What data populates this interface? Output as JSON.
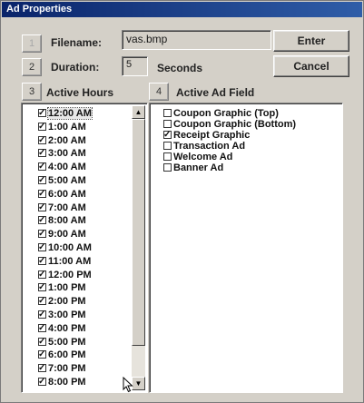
{
  "window": {
    "title": "Ad Properties"
  },
  "row1": {
    "num": "1",
    "label": "Filename:",
    "value": "vas.bmp",
    "button": "Enter"
  },
  "row2": {
    "num": "2",
    "label": "Duration:",
    "value": "5",
    "unit": "Seconds",
    "button": "Cancel"
  },
  "active_hours": {
    "num": "3",
    "label": "Active Hours",
    "items": [
      {
        "label": "12:00 AM",
        "checked": true
      },
      {
        "label": "1:00 AM",
        "checked": true
      },
      {
        "label": "2:00 AM",
        "checked": true
      },
      {
        "label": "3:00 AM",
        "checked": true
      },
      {
        "label": "4:00 AM",
        "checked": true
      },
      {
        "label": "5:00 AM",
        "checked": true
      },
      {
        "label": "6:00 AM",
        "checked": true
      },
      {
        "label": "7:00 AM",
        "checked": true
      },
      {
        "label": "8:00 AM",
        "checked": true
      },
      {
        "label": "9:00 AM",
        "checked": true
      },
      {
        "label": "10:00 AM",
        "checked": true
      },
      {
        "label": "11:00 AM",
        "checked": true
      },
      {
        "label": "12:00 PM",
        "checked": true
      },
      {
        "label": "1:00 PM",
        "checked": true
      },
      {
        "label": "2:00 PM",
        "checked": true
      },
      {
        "label": "3:00 PM",
        "checked": true
      },
      {
        "label": "4:00 PM",
        "checked": true
      },
      {
        "label": "5:00 PM",
        "checked": true
      },
      {
        "label": "6:00 PM",
        "checked": true
      },
      {
        "label": "7:00 PM",
        "checked": true
      },
      {
        "label": "8:00 PM",
        "checked": true
      }
    ]
  },
  "active_ad_field": {
    "num": "4",
    "label": "Active Ad Field",
    "items": [
      {
        "label": "Coupon Graphic (Top)",
        "checked": false
      },
      {
        "label": "Coupon Graphic (Bottom)",
        "checked": false
      },
      {
        "label": "Receipt Graphic",
        "checked": true
      },
      {
        "label": "Transaction Ad",
        "checked": false
      },
      {
        "label": "Welcome Ad",
        "checked": false
      },
      {
        "label": "Banner Ad",
        "checked": false
      }
    ]
  },
  "icons": {
    "scroll_up": "arrow-up-icon",
    "scroll_down": "arrow-down-icon",
    "pointer": "mouse-pointer-icon"
  }
}
